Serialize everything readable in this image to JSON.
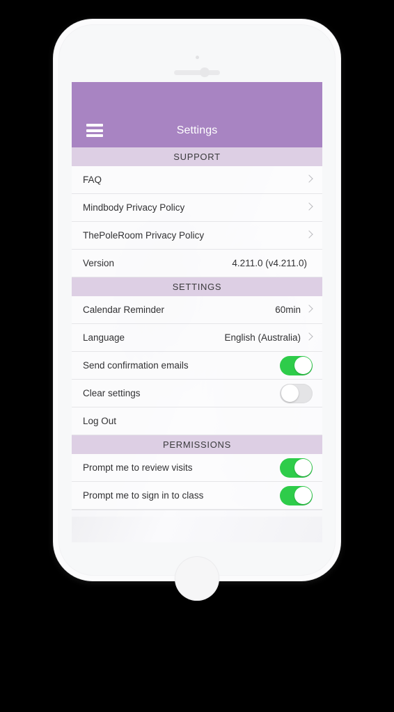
{
  "device": {
    "frame_color": "#fbfbfc",
    "backdrop_color": "#000000"
  },
  "theme": {
    "navbar_color": "#a884c2",
    "section_header_color": "#ddcfe4",
    "toggle_on_color": "#2ecc4a",
    "toggle_off_color": "#e4e4e6",
    "row_background": "#fcfcfd",
    "text_color": "#313133",
    "chevron_color": "#b9b9bd"
  },
  "navbar": {
    "title": "Settings",
    "menu_icon": "hamburger-menu-icon"
  },
  "sections": [
    {
      "header": "SUPPORT",
      "rows": [
        {
          "label": "FAQ",
          "type": "disclosure",
          "value": ""
        },
        {
          "label": "Mindbody Privacy Policy",
          "type": "disclosure",
          "value": ""
        },
        {
          "label": "ThePoleRoom Privacy Policy",
          "type": "disclosure",
          "value": ""
        },
        {
          "label": "Version",
          "type": "value",
          "value": "4.211.0 (v4.211.0)"
        }
      ]
    },
    {
      "header": "SETTINGS",
      "rows": [
        {
          "label": "Calendar Reminder",
          "type": "disclosure-value",
          "value": "60min"
        },
        {
          "label": "Language",
          "type": "disclosure-value",
          "value": "English (Australia)"
        },
        {
          "label": "Send confirmation emails",
          "type": "toggle",
          "value": "on"
        },
        {
          "label": "Clear settings",
          "type": "toggle",
          "value": "off"
        },
        {
          "label": "Log Out",
          "type": "plain",
          "value": ""
        }
      ]
    },
    {
      "header": "PERMISSIONS",
      "rows": [
        {
          "label": "Prompt me to review visits",
          "type": "toggle",
          "value": "on"
        },
        {
          "label": "Prompt me to sign in to class",
          "type": "toggle",
          "value": "on"
        }
      ]
    }
  ]
}
